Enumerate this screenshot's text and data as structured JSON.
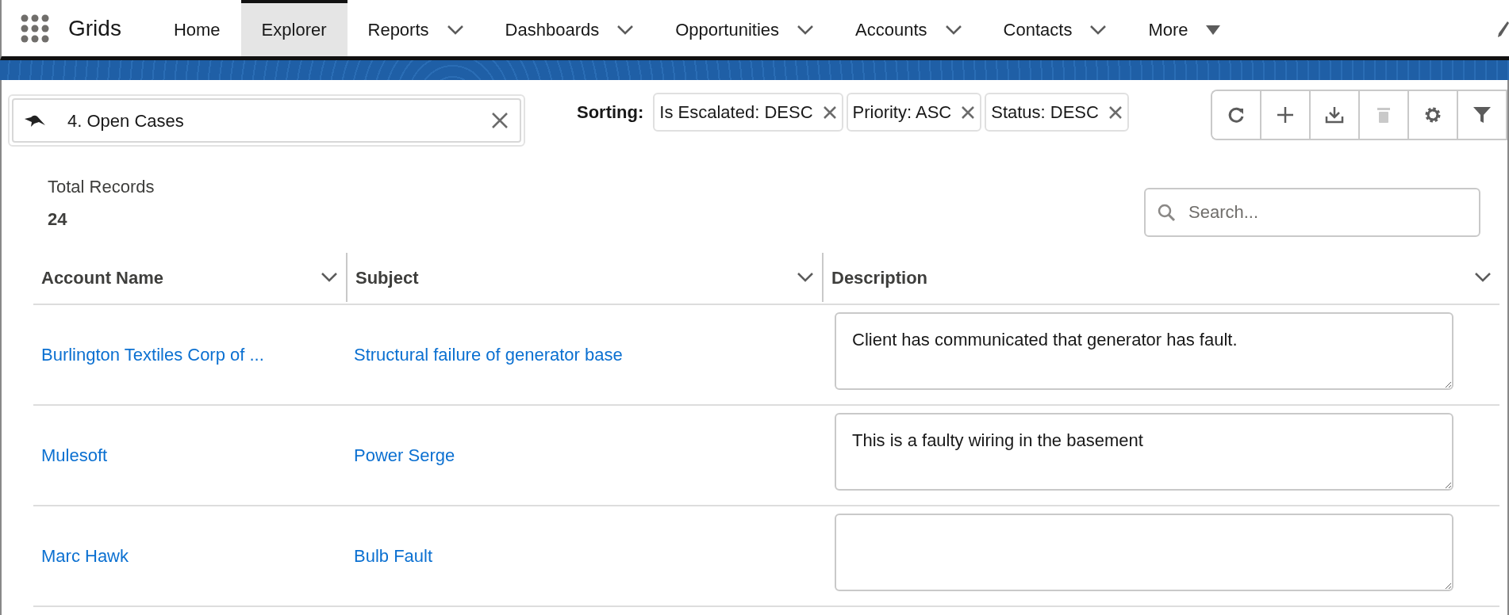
{
  "app": {
    "title": "Grids"
  },
  "nav_tabs": [
    {
      "label": "Home",
      "kind": "plain",
      "selected": false
    },
    {
      "label": "Explorer",
      "kind": "plain",
      "selected": true
    },
    {
      "label": "Reports",
      "kind": "dropdown",
      "selected": false
    },
    {
      "label": "Dashboards",
      "kind": "dropdown",
      "selected": false
    },
    {
      "label": "Opportunities",
      "kind": "dropdown",
      "selected": false
    },
    {
      "label": "Accounts",
      "kind": "dropdown",
      "selected": false
    },
    {
      "label": "Contacts",
      "kind": "dropdown",
      "selected": false
    },
    {
      "label": "More",
      "kind": "more",
      "selected": false
    }
  ],
  "grid_picker": {
    "value": "4. Open Cases"
  },
  "sorting": {
    "label": "Sorting:",
    "chips": [
      "Is Escalated: DESC",
      "Priority: ASC",
      "Status: DESC"
    ]
  },
  "toolbar": [
    {
      "kind": "refresh",
      "disabled": false
    },
    {
      "kind": "add",
      "disabled": false
    },
    {
      "kind": "download",
      "disabled": false
    },
    {
      "kind": "delete",
      "disabled": true
    },
    {
      "kind": "settings",
      "disabled": false
    },
    {
      "kind": "filter",
      "disabled": false
    }
  ],
  "total_records": {
    "label": "Total Records",
    "value": "24"
  },
  "search": {
    "placeholder": "Search..."
  },
  "table": {
    "columns": [
      "Account Name",
      "Subject",
      "Description"
    ],
    "rows": [
      {
        "account": "Burlington Textiles Corp of ...",
        "subject": "Structural failure of generator base",
        "description": "Client has communicated that generator has fault."
      },
      {
        "account": "Mulesoft",
        "subject": "Power Serge",
        "description": "This is a faulty wiring in the basement"
      },
      {
        "account": "Marc Hawk",
        "subject": "Bulb Fault",
        "description": ""
      }
    ]
  }
}
